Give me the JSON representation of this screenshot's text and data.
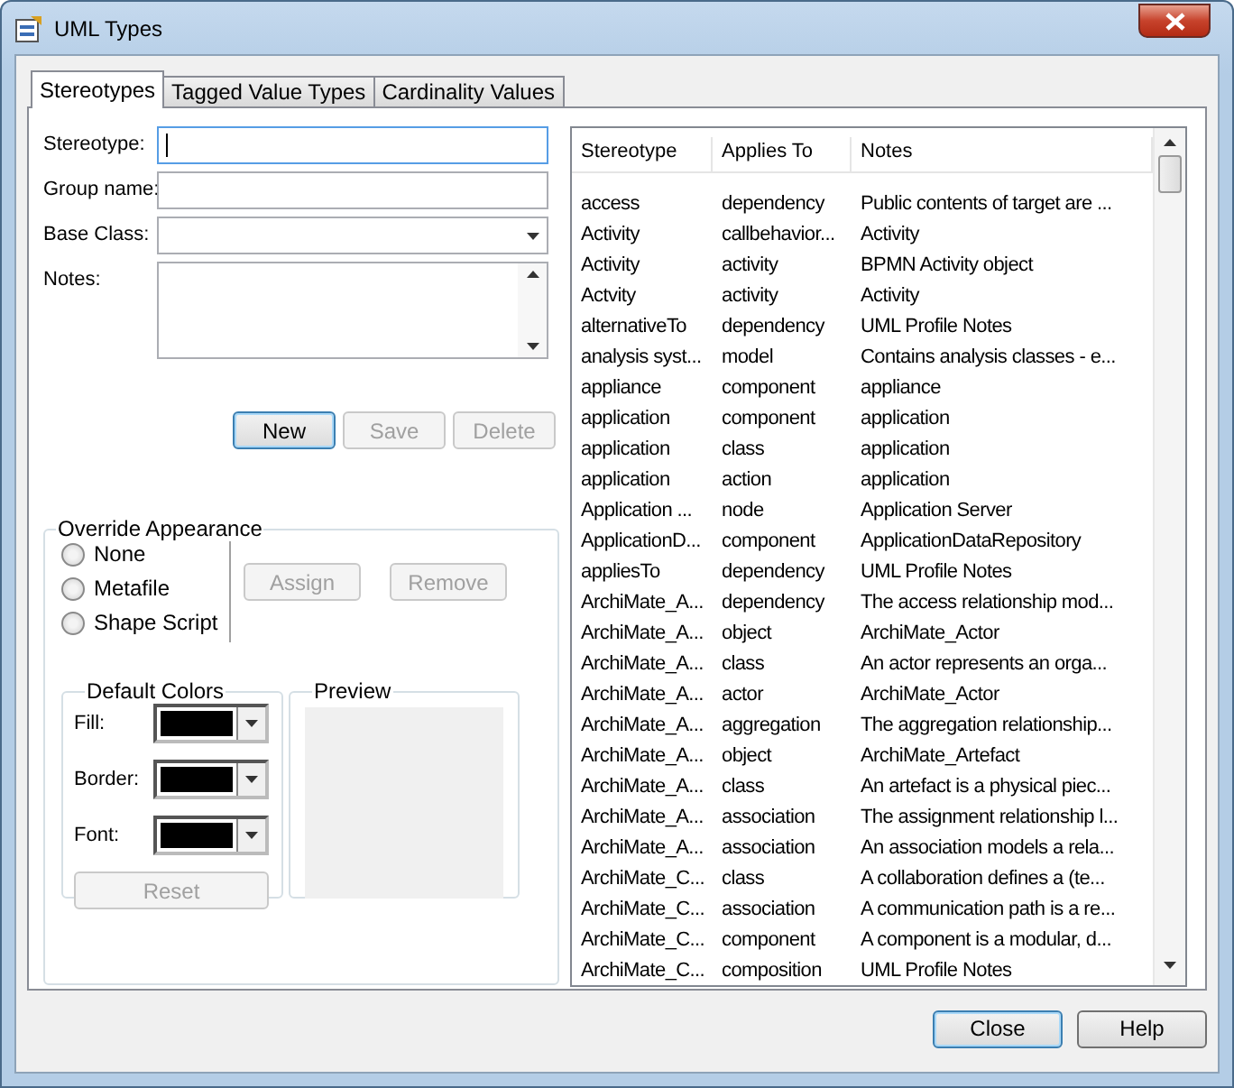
{
  "window": {
    "title": "UML Types"
  },
  "tabs": [
    {
      "label": "Stereotypes",
      "selected": true
    },
    {
      "label": "Tagged Value Types",
      "selected": false
    },
    {
      "label": "Cardinality Values",
      "selected": false
    }
  ],
  "fields": [
    {
      "label": "Stereotype:",
      "kind": "text",
      "focused": true
    },
    {
      "label": "Group name:",
      "kind": "text",
      "focused": false
    },
    {
      "label": "Base Class:",
      "kind": "combo",
      "focused": false
    },
    {
      "label": "Notes:",
      "kind": "memo",
      "focused": false
    }
  ],
  "form_buttons": [
    {
      "label": "New",
      "disabled": false,
      "default": true
    },
    {
      "label": "Save",
      "disabled": true,
      "default": false
    },
    {
      "label": "Delete",
      "disabled": true,
      "default": false
    }
  ],
  "override": {
    "title": "Override Appearance",
    "options": [
      {
        "label": "None",
        "selected": false
      },
      {
        "label": "Metafile",
        "selected": false
      },
      {
        "label": "Shape Script",
        "selected": false
      }
    ],
    "buttons": [
      {
        "label": "Assign",
        "disabled": true
      },
      {
        "label": "Remove",
        "disabled": true
      }
    ]
  },
  "default_colors": {
    "title": "Default Colors",
    "rows": [
      {
        "label": "Fill:",
        "color": "#000000"
      },
      {
        "label": "Border:",
        "color": "#000000"
      },
      {
        "label": "Font:",
        "color": "#000000"
      }
    ],
    "reset": {
      "label": "Reset",
      "disabled": true
    }
  },
  "preview": {
    "title": "Preview"
  },
  "table": {
    "columns": [
      "Stereotype",
      "Applies To",
      "Notes"
    ],
    "rows": [
      [
        "access",
        "dependency",
        "Public contents of target are ..."
      ],
      [
        "Activity",
        "callbehavior...",
        "Activity"
      ],
      [
        "Activity",
        "activity",
        "BPMN Activity object"
      ],
      [
        "Actvity",
        "activity",
        "Activity"
      ],
      [
        "alternativeTo",
        "dependency",
        "UML Profile Notes"
      ],
      [
        "analysis syst...",
        "model",
        "Contains analysis classes - e..."
      ],
      [
        "appliance",
        "component",
        "appliance"
      ],
      [
        "application",
        "component",
        "application"
      ],
      [
        "application",
        "class",
        "application"
      ],
      [
        "application",
        "action",
        "application"
      ],
      [
        "Application ...",
        "node",
        "Application Server"
      ],
      [
        "ApplicationD...",
        "component",
        "ApplicationDataRepository"
      ],
      [
        "appliesTo",
        "dependency",
        "UML Profile Notes"
      ],
      [
        "ArchiMate_A...",
        "dependency",
        "The access relationship mod..."
      ],
      [
        "ArchiMate_A...",
        "object",
        "ArchiMate_Actor"
      ],
      [
        "ArchiMate_A...",
        "class",
        "An actor represents an orga..."
      ],
      [
        "ArchiMate_A...",
        "actor",
        "ArchiMate_Actor"
      ],
      [
        "ArchiMate_A...",
        "aggregation",
        "The aggregation relationship..."
      ],
      [
        "ArchiMate_A...",
        "object",
        "ArchiMate_Artefact"
      ],
      [
        "ArchiMate_A...",
        "class",
        "An artefact is a physical piec..."
      ],
      [
        "ArchiMate_A...",
        "association",
        "The assignment relationship l..."
      ],
      [
        "ArchiMate_A...",
        "association",
        "An association models a rela..."
      ],
      [
        "ArchiMate_C...",
        "class",
        "A collaboration defines a (te..."
      ],
      [
        "ArchiMate_C...",
        "association",
        "A communication path is a re..."
      ],
      [
        "ArchiMate_C...",
        "component",
        "A component is a modular, d..."
      ],
      [
        "ArchiMate_C...",
        "composition",
        "UML Profile Notes"
      ]
    ]
  },
  "footer_buttons": [
    {
      "label": "Close",
      "default": true
    },
    {
      "label": "Help",
      "default": false
    }
  ]
}
